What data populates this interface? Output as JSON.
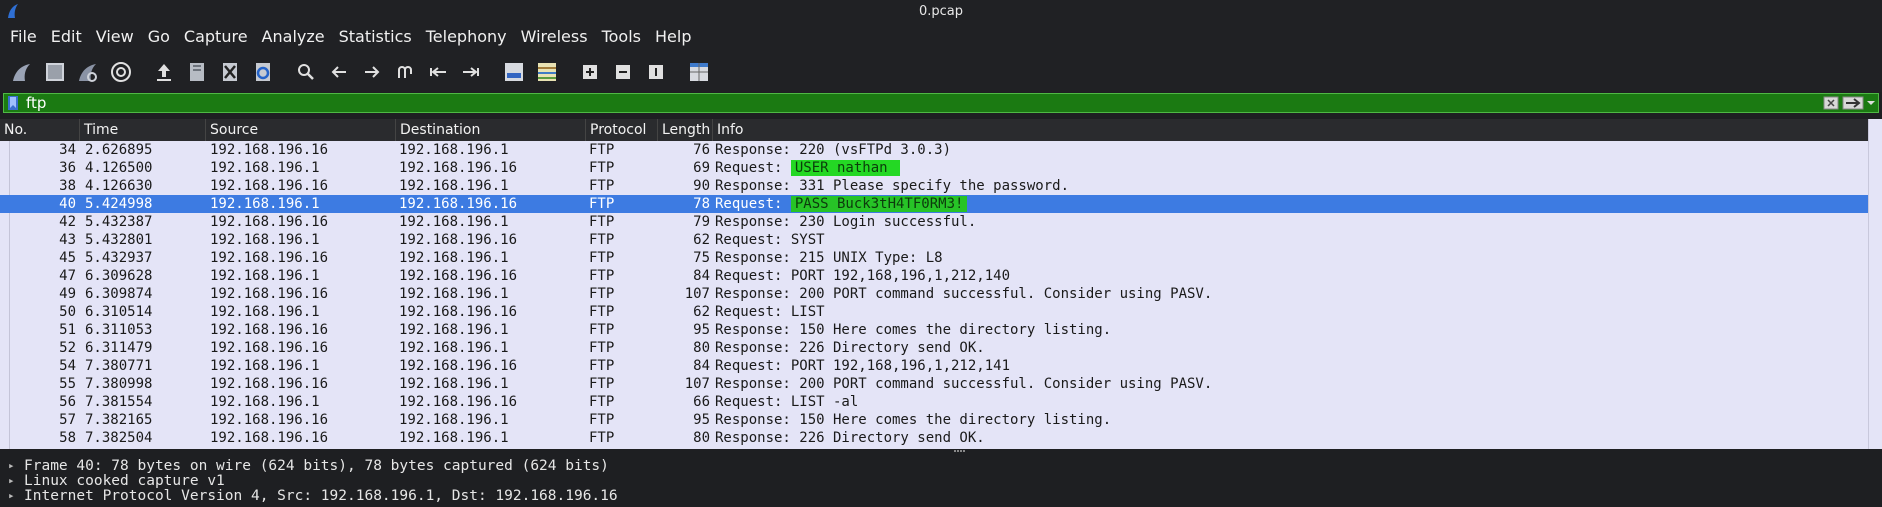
{
  "window": {
    "title": "0.pcap"
  },
  "menu": [
    "File",
    "Edit",
    "View",
    "Go",
    "Capture",
    "Analyze",
    "Statistics",
    "Telephony",
    "Wireless",
    "Tools",
    "Help"
  ],
  "toolbar": {
    "icons": [
      "shark-fin-start-icon",
      "stop-square-icon",
      "shark-fin-restart-icon",
      "gear-options-icon",
      "open-file-icon",
      "save-file-icon",
      "close-file-icon",
      "reload-file-icon",
      "search-icon",
      "back-arrow-icon",
      "forward-arrow-icon",
      "go-to-packet-icon",
      "first-packet-icon",
      "last-packet-icon",
      "autoscroll-icon",
      "colorize-icon",
      "zoom-in-icon",
      "zoom-out-icon",
      "normal-size-icon",
      "resize-columns-icon"
    ]
  },
  "filter": {
    "value": "ftp"
  },
  "columns": {
    "no": "No.",
    "time": "Time",
    "source": "Source",
    "destination": "Destination",
    "protocol": "Protocol",
    "length": "Length",
    "info": "Info"
  },
  "packets": [
    {
      "no": "34",
      "time": "2.626895",
      "source": "192.168.196.16",
      "destination": "192.168.196.1",
      "protocol": "FTP",
      "length": "76",
      "info_prefix": "Response: 220 (vsFTPd 3.0.3)",
      "highlight": ""
    },
    {
      "no": "36",
      "time": "4.126500",
      "source": "192.168.196.1",
      "destination": "192.168.196.16",
      "protocol": "FTP",
      "length": "69",
      "info_prefix": "Request: ",
      "highlight": "USER nathan "
    },
    {
      "no": "38",
      "time": "4.126630",
      "source": "192.168.196.16",
      "destination": "192.168.196.1",
      "protocol": "FTP",
      "length": "90",
      "info_prefix": "Response: 331 Please specify the password.",
      "highlight": ""
    },
    {
      "no": "40",
      "time": "5.424998",
      "source": "192.168.196.1",
      "destination": "192.168.196.16",
      "protocol": "FTP",
      "length": "78",
      "info_prefix": "Request: ",
      "highlight": "PASS Buck3tH4TF0RM3!",
      "selected": true
    },
    {
      "no": "42",
      "time": "5.432387",
      "source": "192.168.196.16",
      "destination": "192.168.196.1",
      "protocol": "FTP",
      "length": "79",
      "info_prefix": "Response: 230 Login successful.",
      "highlight": ""
    },
    {
      "no": "43",
      "time": "5.432801",
      "source": "192.168.196.1",
      "destination": "192.168.196.16",
      "protocol": "FTP",
      "length": "62",
      "info_prefix": "Request: SYST",
      "highlight": ""
    },
    {
      "no": "45",
      "time": "5.432937",
      "source": "192.168.196.16",
      "destination": "192.168.196.1",
      "protocol": "FTP",
      "length": "75",
      "info_prefix": "Response: 215 UNIX Type: L8",
      "highlight": ""
    },
    {
      "no": "47",
      "time": "6.309628",
      "source": "192.168.196.1",
      "destination": "192.168.196.16",
      "protocol": "FTP",
      "length": "84",
      "info_prefix": "Request: PORT 192,168,196,1,212,140",
      "highlight": ""
    },
    {
      "no": "49",
      "time": "6.309874",
      "source": "192.168.196.16",
      "destination": "192.168.196.1",
      "protocol": "FTP",
      "length": "107",
      "info_prefix": "Response: 200 PORT command successful. Consider using PASV.",
      "highlight": ""
    },
    {
      "no": "50",
      "time": "6.310514",
      "source": "192.168.196.1",
      "destination": "192.168.196.16",
      "protocol": "FTP",
      "length": "62",
      "info_prefix": "Request: LIST",
      "highlight": ""
    },
    {
      "no": "51",
      "time": "6.311053",
      "source": "192.168.196.16",
      "destination": "192.168.196.1",
      "protocol": "FTP",
      "length": "95",
      "info_prefix": "Response: 150 Here comes the directory listing.",
      "highlight": ""
    },
    {
      "no": "52",
      "time": "6.311479",
      "source": "192.168.196.16",
      "destination": "192.168.196.1",
      "protocol": "FTP",
      "length": "80",
      "info_prefix": "Response: 226 Directory send OK.",
      "highlight": ""
    },
    {
      "no": "54",
      "time": "7.380771",
      "source": "192.168.196.1",
      "destination": "192.168.196.16",
      "protocol": "FTP",
      "length": "84",
      "info_prefix": "Request: PORT 192,168,196,1,212,141",
      "highlight": ""
    },
    {
      "no": "55",
      "time": "7.380998",
      "source": "192.168.196.16",
      "destination": "192.168.196.1",
      "protocol": "FTP",
      "length": "107",
      "info_prefix": "Response: 200 PORT command successful. Consider using PASV.",
      "highlight": ""
    },
    {
      "no": "56",
      "time": "7.381554",
      "source": "192.168.196.1",
      "destination": "192.168.196.16",
      "protocol": "FTP",
      "length": "66",
      "info_prefix": "Request: LIST -al",
      "highlight": ""
    },
    {
      "no": "57",
      "time": "7.382165",
      "source": "192.168.196.16",
      "destination": "192.168.196.1",
      "protocol": "FTP",
      "length": "95",
      "info_prefix": "Response: 150 Here comes the directory listing.",
      "highlight": ""
    },
    {
      "no": "58",
      "time": "7.382504",
      "source": "192.168.196.16",
      "destination": "192.168.196.1",
      "protocol": "FTP",
      "length": "80",
      "info_prefix": "Response: 226 Directory send OK.",
      "highlight": ""
    }
  ],
  "details": [
    "Frame 40: 78 bytes on wire (624 bits), 78 bytes captured (624 bits)",
    "Linux cooked capture v1",
    "Internet Protocol Version 4, Src: 192.168.196.1, Dst: 192.168.196.16"
  ],
  "colors": {
    "row_bg": "#e4e4f7",
    "selected_bg": "#3d7be2",
    "filter_bg": "#1b7a12",
    "highlight": "#24d824"
  }
}
